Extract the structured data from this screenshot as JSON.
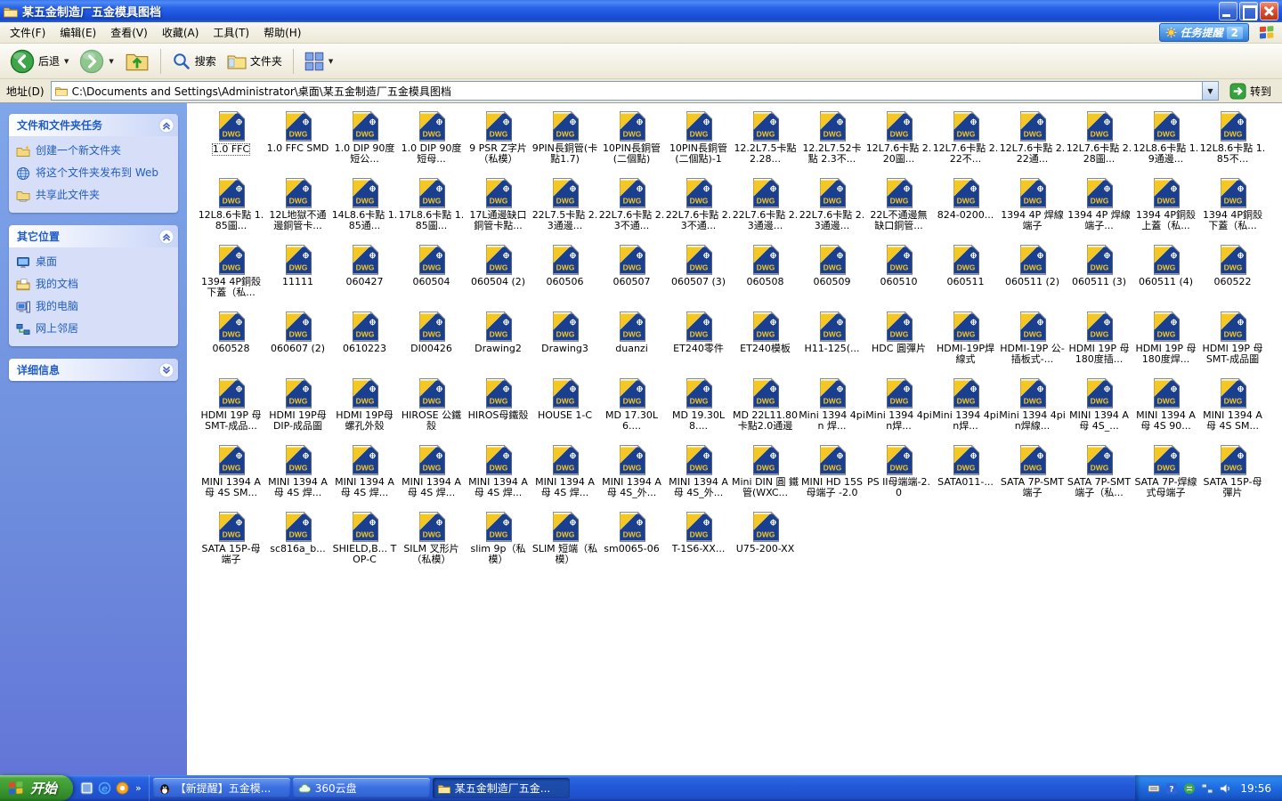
{
  "window": {
    "title": "某五金制造厂五金模具图档",
    "menu": [
      "文件(F)",
      "编辑(E)",
      "查看(V)",
      "收藏(A)",
      "工具(T)",
      "帮助(H)"
    ],
    "task_reminder": "任务提醒",
    "task_reminder_count": "2"
  },
  "toolbar": {
    "back_label": "后退",
    "search_label": "搜索",
    "folders_label": "文件夹"
  },
  "address": {
    "label": "地址(D)",
    "value": "C:\\Documents and Settings\\Administrator\\桌面\\某五金制造厂五金模具图档",
    "go_label": "转到"
  },
  "sidebar": {
    "sections": [
      {
        "title": "文件和文件夹任务",
        "collapsed": false,
        "items": [
          {
            "icon": "new-folder",
            "label": "创建一个新文件夹"
          },
          {
            "icon": "publish-web",
            "label": "将这个文件夹发布到 Web"
          },
          {
            "icon": "share-folder",
            "label": "共享此文件夹"
          }
        ]
      },
      {
        "title": "其它位置",
        "collapsed": false,
        "items": [
          {
            "icon": "desktop",
            "label": "桌面"
          },
          {
            "icon": "my-documents",
            "label": "我的文档"
          },
          {
            "icon": "my-computer",
            "label": "我的电脑"
          },
          {
            "icon": "network",
            "label": "网上邻居"
          }
        ]
      },
      {
        "title": "详细信息",
        "collapsed": true,
        "items": []
      }
    ]
  },
  "files": [
    "1.0 FFC",
    "1.0 FFC SMD",
    "1.0 DIP 90度 短公...",
    "1.0 DIP 90度 短母...",
    "9 PSR Z字片（私模）",
    "9PIN長銅管(卡點1.7)",
    "10PIN長銅管(二個點)",
    "10PIN長銅管(二個點)-1",
    "12.2L7.5卡點 2.28...",
    "12.2L7.52卡點 2.3不...",
    "12L7.6卡點 2.20圖...",
    "12L7.6卡點 2.22不...",
    "12L7.6卡點 2.22通...",
    "12L7.6卡點 2.28圖...",
    "12L8.6卡點 1.9通邊...",
    "12L8.6卡點 1.85不...",
    "12L8.6卡點 1.85圖...",
    "12L地獄不通邊銅管卡...",
    "14L8.6卡點 1.85通...",
    "17L8.6卡點 1.85圖...",
    "17L通邊缺口銅管卡點...",
    "22L7.5卡點 2.3通邊...",
    "22L7.6卡點 2.3不通...",
    "22L7.6卡點 2.3不通...",
    "22L7.6卡點 2.3通邊...",
    "22L7.6卡點 2.3通邊...",
    "22L不通邊無缺口銅管...",
    "824-0200...",
    "1394 4P 焊線端子",
    "1394 4P 焊線端子...",
    "1394 4P銅殼上蓋（私...",
    "1394 4P銅殼下蓋（私...",
    "1394 4P銅殼下蓋（私...",
    "11111",
    "060427",
    "060504",
    "060504 (2)",
    "060506",
    "060507",
    "060507 (3)",
    "060508",
    "060509",
    "060510",
    "060511",
    "060511 (2)",
    "060511 (3)",
    "060511 (4)",
    "060522",
    "060528",
    "060607 (2)",
    "0610223",
    "DI00426",
    "Drawing2",
    "Drawing3",
    "duanzi",
    "ET240零件",
    "ET240模板",
    "H11-125(...",
    "HDC 圓彈片",
    "HDMI-19P焊線式",
    "HDMI-19P 公-插板式-...",
    "HDMI 19P 母 180度插...",
    "HDMI 19P 母 180度焊...",
    "HDMI 19P 母 SMT-成品圖",
    "HDMI 19P 母 SMT-成品...",
    "HDMI 19P母 DIP-成品圖",
    "HDMI 19P母 螺孔外殼",
    "HIROSE 公鐵殼",
    "HIROS母鐵殼",
    "HOUSE 1-C",
    "MD 17.30L6....",
    "MD 19.30L8....",
    "MD 22L11.80 卡點2.0通邊",
    "Mini 1394 4pin 焊...",
    "Mini 1394 4pin焊...",
    "Mini 1394 4pin焊...",
    "Mini 1394 4pin焊線...",
    "MINI 1394 A母 4S_...",
    "MINI 1394 A 母 4S 90...",
    "MINI 1394 A 母 4S SM...",
    "MINI 1394 A 母 4S SM...",
    "MINI 1394 A 母 4S 焊...",
    "MINI 1394 A 母 4S 焊...",
    "MINI 1394 A 母 4S 焊...",
    "MINI 1394 A 母 4S 焊...",
    "MINI 1394 A 母 4S 焊...",
    "MINI 1394 A 母 4S_外...",
    "MINI 1394 A 母 4S_外...",
    "Mini DIN 圓 鐵管(WXC...",
    "MINI HD 15S 母端子 -2.0",
    "PS II母端端-2.0",
    "SATA011-...",
    "SATA 7P-SMT 端子",
    "SATA 7P-SMT 端子（私...",
    "SATA 7P-焊線式母端子",
    "SATA 15P-母彈片",
    "SATA 15P-母端子",
    "sc816a_b...",
    "SHIELD,B... TOP-C",
    "SILM 叉形片（私模）",
    "slim 9p（私模）",
    "SLIM 短端（私模）",
    "sm0065-06",
    "T-1S6-XX...",
    "U75-200-XX"
  ],
  "taskbar": {
    "start_label": "开始",
    "quicklaunch_icons": [
      "app-1",
      "internet-explorer",
      "app-2"
    ],
    "overflow": "»",
    "tasks": [
      {
        "icon": "qq",
        "label": "【新提醒】五金模...",
        "active": false
      },
      {
        "icon": "cloud",
        "label": "360云盘",
        "active": false
      },
      {
        "icon": "folder",
        "label": "某五金制造厂五金...",
        "active": true
      }
    ],
    "tray_icons": [
      "input-method",
      "help",
      "messenger",
      "network",
      "volume"
    ],
    "time": "19:56"
  },
  "colors": {
    "titlebar_blue": "#1C53DE",
    "taskpane_blue": "#6F8FDD",
    "link_blue": "#215DC6",
    "dwg_navy": "#1B3F8F",
    "dwg_gold": "#F5C723",
    "start_green": "#3E9A31"
  }
}
